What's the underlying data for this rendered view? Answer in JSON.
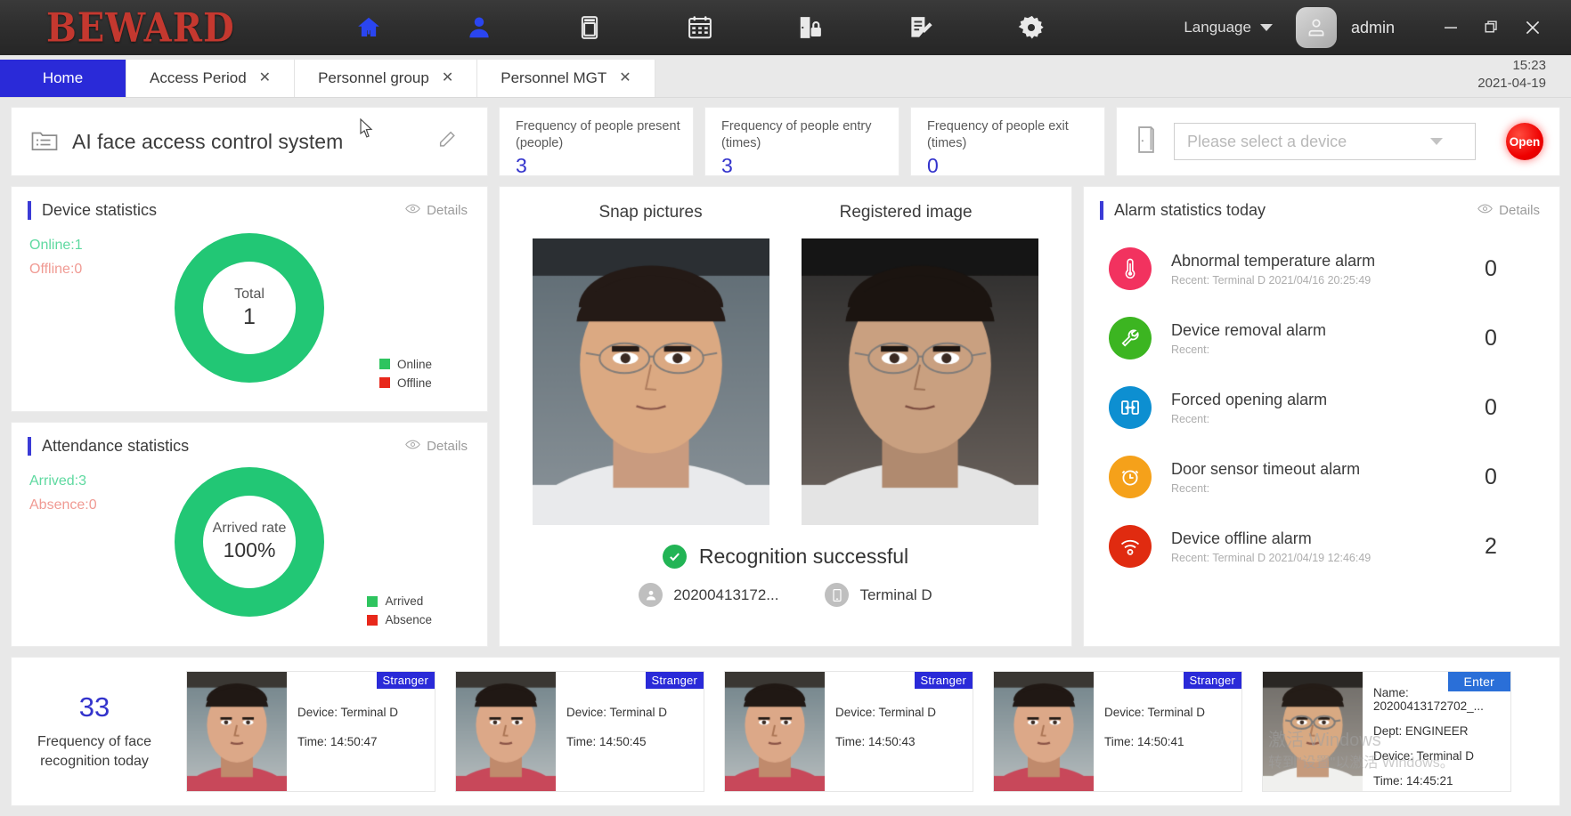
{
  "titlebar": {
    "brand": "BEWARD",
    "nav_icons": [
      {
        "name": "home-icon",
        "label": "Home"
      },
      {
        "name": "person-icon",
        "label": "Personnel"
      },
      {
        "name": "device-terminal-icon",
        "label": "Device"
      },
      {
        "name": "calendar-icon",
        "label": "Attendance"
      },
      {
        "name": "door-lock-icon",
        "label": "Access Control"
      },
      {
        "name": "report-edit-icon",
        "label": "Records"
      },
      {
        "name": "gear-icon",
        "label": "Settings"
      }
    ],
    "language_label": "Language",
    "username": "admin",
    "window_buttons": [
      "minimize",
      "restore",
      "close"
    ]
  },
  "tabs": [
    {
      "label": "Home",
      "active": true,
      "closable": false
    },
    {
      "label": "Access Period",
      "active": false,
      "closable": true
    },
    {
      "label": "Personnel group",
      "active": false,
      "closable": true
    },
    {
      "label": "Personnel MGT",
      "active": false,
      "closable": true
    }
  ],
  "clock": {
    "time": "15:23",
    "date": "2021-04-19"
  },
  "header": {
    "system_title": "AI face access control system",
    "edit_icon": "pencil-icon"
  },
  "stats": [
    {
      "label": "Frequency of people present (people)",
      "value": "3"
    },
    {
      "label": "Frequency of people entry (times)",
      "value": "3"
    },
    {
      "label": "Frequency of people exit (times)",
      "value": "0"
    }
  ],
  "device_control": {
    "icon": "door-icon",
    "placeholder": "Please select a device",
    "open_label": "Open"
  },
  "device_statistics": {
    "title": "Device statistics",
    "details_label": "Details",
    "online_text": "Online:1",
    "offline_text": "Offline:0",
    "center_label": "Total",
    "center_value": "1",
    "legend": [
      {
        "label": "Online",
        "color": "#2ec45f"
      },
      {
        "label": "Offline",
        "color": "#e8281b"
      }
    ]
  },
  "attendance_statistics": {
    "title": "Attendance statistics",
    "details_label": "Details",
    "arrived_text": "Arrived:3",
    "absence_text": "Absence:0",
    "center_label": "Arrived rate",
    "center_value": "100%",
    "legend": [
      {
        "label": "Arrived",
        "color": "#2ec45f"
      },
      {
        "label": "Absence",
        "color": "#e8281b"
      }
    ]
  },
  "recognition": {
    "snap_heading": "Snap pictures",
    "registered_heading": "Registered image",
    "status_text": "Recognition successful",
    "person_id": "20200413172...",
    "device_name": "Terminal D"
  },
  "alarm_statistics": {
    "title": "Alarm statistics today",
    "details_label": "Details",
    "rows": [
      {
        "icon": "thermometer-icon",
        "color": "#f2325f",
        "title": "Abnormal temperature alarm",
        "recent": "Recent: Terminal D 2021/04/16 20:25:49",
        "count": "0"
      },
      {
        "icon": "wrench-icon",
        "color": "#3cb521",
        "title": "Device removal alarm",
        "recent": "Recent:",
        "count": "0"
      },
      {
        "icon": "forced-door-icon",
        "color": "#0d8fd1",
        "title": "Forced opening alarm",
        "recent": "Recent:",
        "count": "0"
      },
      {
        "icon": "clock-alarm-icon",
        "color": "#f5a11a",
        "title": "Door sensor timeout alarm",
        "recent": "Recent:",
        "count": "0"
      },
      {
        "icon": "wifi-off-icon",
        "color": "#e02b10",
        "title": "Device offline alarm",
        "recent": "Recent: Terminal D 2021/04/19 12:46:49",
        "count": "2"
      }
    ]
  },
  "face_feed": {
    "count": "33",
    "count_label": "Frequency of face recognition today",
    "device_prefix": "Device: ",
    "time_prefix": "Time: ",
    "name_prefix": "Name: ",
    "dept_prefix": "Dept: ",
    "cards": [
      {
        "badge": "Stranger",
        "badge_type": "stranger",
        "device": "Device: Terminal D",
        "time": "Time: 14:50:47"
      },
      {
        "badge": "Stranger",
        "badge_type": "stranger",
        "device": "Device: Terminal D",
        "time": "Time: 14:50:45"
      },
      {
        "badge": "Stranger",
        "badge_type": "stranger",
        "device": "Device: Terminal D",
        "time": "Time: 14:50:43"
      },
      {
        "badge": "Stranger",
        "badge_type": "stranger",
        "device": "Device: Terminal D",
        "time": "Time: 14:50:41"
      },
      {
        "badge": "Enter",
        "badge_type": "enter",
        "name": "Name: 20200413172702_...",
        "dept": "Dept: ENGINEER",
        "device": "Device: Terminal D",
        "time": "Time: 14:45:21"
      }
    ]
  },
  "watermark": {
    "line1": "激活 Windows",
    "line2": "转到\"设置\"以激活 Windows。"
  },
  "colors": {
    "accent_blue": "#2a2ad8",
    "value_blue": "#3333cc",
    "donut_green": "#22c775",
    "open_red": "#ee0000"
  }
}
